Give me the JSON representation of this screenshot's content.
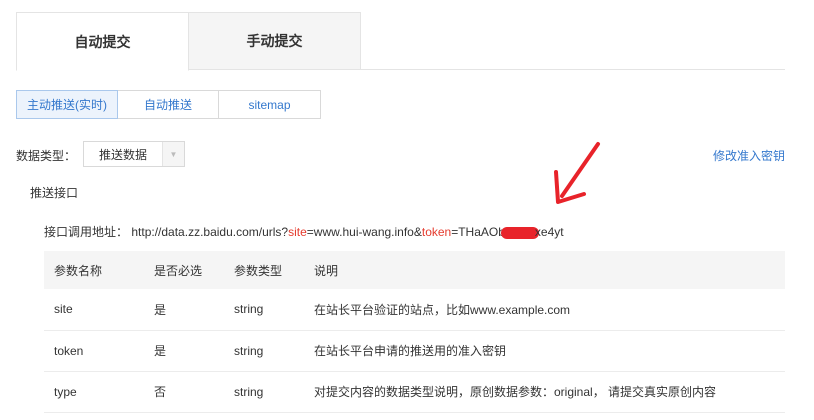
{
  "top_tabs": [
    "自动提交",
    "手动提交"
  ],
  "sub_tabs": [
    "主动推送(实时)",
    "自动推送",
    "sitemap"
  ],
  "data_type": {
    "label": "数据类型：",
    "value": "推送数据",
    "modify_link": "修改准入密钥"
  },
  "section_title": "推送接口",
  "api": {
    "label": "接口调用地址：",
    "url_prefix": "http://data.zz.baidu.com/urls?",
    "param1_name": "site",
    "param1_value": "=www.hui-wang.info&",
    "param2_name": "token",
    "token_start": "=THaAOb",
    "token_end": "xe4yt"
  },
  "colors": {
    "link": "#3478cd",
    "highlight": "#e53b2e",
    "annotation": "#e8232a"
  },
  "table": {
    "headers": [
      "参数名称",
      "是否必选",
      "参数类型",
      "说明"
    ],
    "rows": [
      [
        "site",
        "是",
        "string",
        "在站长平台验证的站点，比如www.example.com"
      ],
      [
        "token",
        "是",
        "string",
        "在站长平台申请的推送用的准入密钥"
      ],
      [
        "type",
        "否",
        "string",
        "对提交内容的数据类型说明，原创数据参数：original， 请提交真实原创内容"
      ]
    ]
  }
}
